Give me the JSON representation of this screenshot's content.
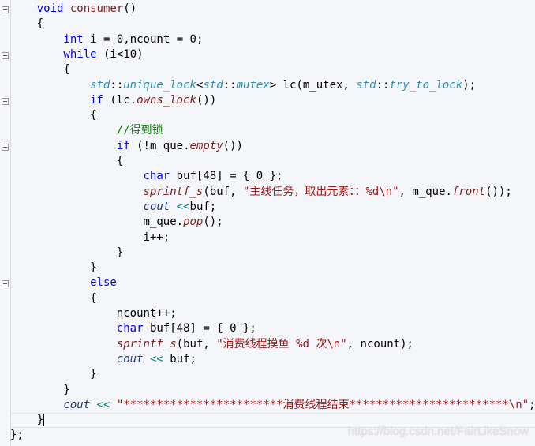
{
  "editor": {
    "watermark": "https://blog.csdn.net/FairLikeSnow",
    "current_line": 28,
    "lines": [
      {
        "indent": 1,
        "fold": true,
        "tokens": [
          [
            "void",
            "kw"
          ],
          [
            " ",
            ""
          ],
          [
            "consumer",
            "fn"
          ],
          [
            "()",
            ""
          ]
        ]
      },
      {
        "indent": 1,
        "tokens": [
          [
            "{",
            ""
          ]
        ]
      },
      {
        "indent": 2,
        "tokens": [
          [
            "int",
            "kw"
          ],
          [
            " i = 0,ncount = 0;",
            ""
          ]
        ]
      },
      {
        "indent": 2,
        "fold": true,
        "tokens": [
          [
            "while",
            "kw"
          ],
          [
            " (i<10)",
            ""
          ]
        ]
      },
      {
        "indent": 2,
        "tokens": [
          [
            "{",
            ""
          ]
        ]
      },
      {
        "indent": 3,
        "tokens": [
          [
            "std",
            "ty"
          ],
          [
            "::",
            ""
          ],
          [
            "unique_lock",
            "ty"
          ],
          [
            "<",
            ""
          ],
          [
            "std",
            "ty"
          ],
          [
            "::",
            ""
          ],
          [
            "mutex",
            "ty"
          ],
          [
            "> lc(m_utex, ",
            ""
          ],
          [
            "std",
            "ty"
          ],
          [
            "::",
            ""
          ],
          [
            "try_to_lock",
            "ty"
          ],
          [
            ");",
            ""
          ]
        ]
      },
      {
        "indent": 3,
        "fold": true,
        "tokens": [
          [
            "if",
            "kw"
          ],
          [
            " (lc.",
            ""
          ],
          [
            "owns_lock",
            "me"
          ],
          [
            "())",
            ""
          ]
        ]
      },
      {
        "indent": 3,
        "tokens": [
          [
            "{",
            ""
          ]
        ]
      },
      {
        "indent": 4,
        "tokens": [
          [
            "//得到锁",
            "cm"
          ]
        ]
      },
      {
        "indent": 4,
        "fold": true,
        "tokens": [
          [
            "if",
            "kw"
          ],
          [
            " (!m_que.",
            ""
          ],
          [
            "empty",
            "me"
          ],
          [
            "())",
            ""
          ]
        ]
      },
      {
        "indent": 4,
        "tokens": [
          [
            "{",
            ""
          ]
        ]
      },
      {
        "indent": 5,
        "tokens": [
          [
            "char",
            "kw"
          ],
          [
            " buf[48] = { 0 };",
            ""
          ]
        ]
      },
      {
        "indent": 5,
        "tokens": [
          [
            "sprintf_s",
            "me"
          ],
          [
            "(buf, ",
            ""
          ],
          [
            "\"主线任务，取出元素：：%d\\n\"",
            "str"
          ],
          [
            ", m_que.",
            ""
          ],
          [
            "front",
            "me"
          ],
          [
            "());",
            ""
          ]
        ]
      },
      {
        "indent": 5,
        "tokens": [
          [
            "cout",
            "io"
          ],
          [
            " ",
            ""
          ],
          [
            "<<",
            "op"
          ],
          [
            "buf;",
            ""
          ]
        ]
      },
      {
        "indent": 5,
        "tokens": [
          [
            "m_que.",
            ""
          ],
          [
            "pop",
            "me"
          ],
          [
            "();",
            ""
          ]
        ]
      },
      {
        "indent": 5,
        "tokens": [
          [
            "i++;",
            ""
          ]
        ]
      },
      {
        "indent": 4,
        "tokens": [
          [
            "}",
            ""
          ]
        ]
      },
      {
        "indent": 3,
        "tokens": [
          [
            "}",
            ""
          ]
        ]
      },
      {
        "indent": 3,
        "fold": true,
        "tokens": [
          [
            "else",
            "kw"
          ]
        ]
      },
      {
        "indent": 3,
        "tokens": [
          [
            "{",
            ""
          ]
        ]
      },
      {
        "indent": 4,
        "tokens": [
          [
            "ncount++;",
            ""
          ]
        ]
      },
      {
        "indent": 4,
        "tokens": [
          [
            "char",
            "kw"
          ],
          [
            " buf[48] = { 0 };",
            ""
          ]
        ]
      },
      {
        "indent": 4,
        "tokens": [
          [
            "sprintf_s",
            "me"
          ],
          [
            "(buf, ",
            ""
          ],
          [
            "\"消费线程摸鱼 %d 次\\n\"",
            "str"
          ],
          [
            ", ncount);",
            ""
          ]
        ]
      },
      {
        "indent": 4,
        "tokens": [
          [
            "cout",
            "io"
          ],
          [
            " ",
            ""
          ],
          [
            "<<",
            "op"
          ],
          [
            " buf;",
            ""
          ]
        ]
      },
      {
        "indent": 3,
        "tokens": [
          [
            "}",
            ""
          ]
        ]
      },
      {
        "indent": 2,
        "tokens": [
          [
            "}",
            ""
          ]
        ]
      },
      {
        "indent": 2,
        "tokens": [
          [
            "cout",
            "io"
          ],
          [
            " ",
            ""
          ],
          [
            "<<",
            "op"
          ],
          [
            " ",
            ""
          ],
          [
            "\"************************消费线程结束************************\\n\"",
            "str"
          ],
          [
            ";",
            ""
          ]
        ]
      },
      {
        "indent": 1,
        "tokens": [
          [
            "}",
            ""
          ]
        ]
      },
      {
        "indent": 0,
        "tokens": [
          [
            "};",
            ""
          ]
        ]
      }
    ]
  }
}
